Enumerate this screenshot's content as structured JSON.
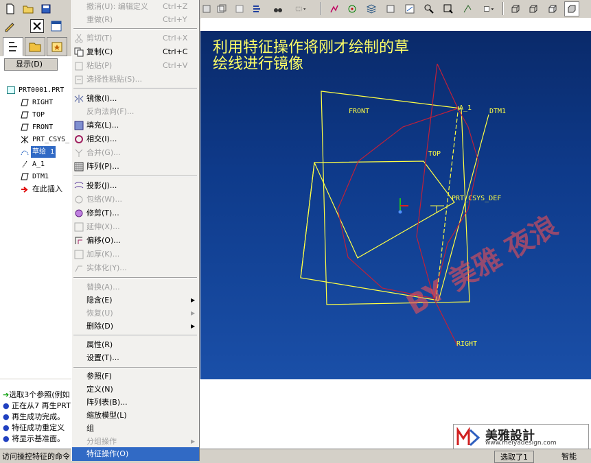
{
  "colors": {
    "caption": "#ffff66",
    "geometry": "#ffff44",
    "sketch": "#c0203a",
    "highlight": "#316ac5",
    "viewport_bg": "#0e3a8a"
  },
  "toolbar": {
    "icons": [
      "new-file-icon",
      "open-folder-icon",
      "save-icon",
      "show-icon",
      "view-icon",
      "repaint-icon",
      "saved-views-icon",
      "datum-plane-display-icon",
      "datum-axis-display-icon",
      "datum-point-display-icon",
      "csys-display-icon",
      "layers-icon",
      "zoom-in-icon",
      "zoom-out-icon",
      "refit-icon",
      "orient-icon",
      "wireframe-icon",
      "hidden-line-icon",
      "no-hidden-icon",
      "shading-icon"
    ]
  },
  "left_panel": {
    "show_button": "显示(D)",
    "tree": [
      {
        "label": "PRT0001.PRT",
        "icon": "part-icon"
      },
      {
        "label": "RIGHT",
        "icon": "datum-plane-icon"
      },
      {
        "label": "TOP",
        "icon": "datum-plane-icon"
      },
      {
        "label": "FRONT",
        "icon": "datum-plane-icon"
      },
      {
        "label": "PRT_CSYS_",
        "icon": "csys-icon"
      },
      {
        "label": "草绘 1",
        "icon": "sketch-icon"
      },
      {
        "label": "A_1",
        "icon": "datum-axis-icon"
      },
      {
        "label": "DTM1",
        "icon": "datum-plane-icon"
      },
      {
        "label": "在此插入",
        "icon": "insert-here-icon"
      }
    ]
  },
  "menu": {
    "items": [
      {
        "label": "撤消(U): 编辑定义",
        "shortcut": "Ctrl+Z",
        "disabled": true,
        "icon": ""
      },
      {
        "label": "重做(R)",
        "shortcut": "Ctrl+Y",
        "disabled": true,
        "icon": ""
      },
      {
        "label": "剪切(T)",
        "shortcut": "Ctrl+X",
        "disabled": true,
        "icon": "cut-icon"
      },
      {
        "label": "复制(C)",
        "shortcut": "Ctrl+C",
        "disabled": false,
        "icon": "copy-icon"
      },
      {
        "label": "粘贴(P)",
        "shortcut": "Ctrl+V",
        "disabled": true,
        "icon": "paste-icon"
      },
      {
        "label": "选择性粘贴(S)...",
        "shortcut": "",
        "disabled": true,
        "icon": "paste-special-icon"
      },
      {
        "label": "镜像(I)...",
        "shortcut": "",
        "disabled": false,
        "icon": "mirror-icon"
      },
      {
        "label": "反向法向(F)...",
        "shortcut": "",
        "disabled": true,
        "icon": ""
      },
      {
        "label": "填充(L)...",
        "shortcut": "",
        "disabled": false,
        "icon": "fill-icon"
      },
      {
        "label": "相交(I)...",
        "shortcut": "",
        "disabled": false,
        "icon": "intersect-icon"
      },
      {
        "label": "合并(G)...",
        "shortcut": "",
        "disabled": true,
        "icon": "merge-icon"
      },
      {
        "label": "阵列(P)...",
        "shortcut": "",
        "disabled": false,
        "icon": "pattern-icon"
      },
      {
        "label": "投影(J)...",
        "shortcut": "",
        "disabled": false,
        "icon": "project-icon"
      },
      {
        "label": "包络(W)...",
        "shortcut": "",
        "disabled": true,
        "icon": "wrap-icon"
      },
      {
        "label": "修剪(T)...",
        "shortcut": "",
        "disabled": false,
        "icon": "trim-icon"
      },
      {
        "label": "延伸(X)...",
        "shortcut": "",
        "disabled": true,
        "icon": "extend-icon"
      },
      {
        "label": "偏移(O)...",
        "shortcut": "",
        "disabled": false,
        "icon": "offset-icon"
      },
      {
        "label": "加厚(K)...",
        "shortcut": "",
        "disabled": true,
        "icon": "thicken-icon"
      },
      {
        "label": "实体化(Y)...",
        "shortcut": "",
        "disabled": true,
        "icon": "solidify-icon"
      },
      {
        "label": "替换(A)...",
        "shortcut": "",
        "disabled": true,
        "icon": ""
      },
      {
        "label": "隐含(E)",
        "shortcut": "",
        "disabled": false,
        "icon": "",
        "submenu": true
      },
      {
        "label": "恢复(U)",
        "shortcut": "",
        "disabled": true,
        "icon": "",
        "submenu": true
      },
      {
        "label": "删除(D)",
        "shortcut": "",
        "disabled": false,
        "icon": "",
        "submenu": true
      },
      {
        "label": "属性(R)",
        "shortcut": "",
        "disabled": false,
        "icon": ""
      },
      {
        "label": "设置(T)...",
        "shortcut": "",
        "disabled": false,
        "icon": ""
      },
      {
        "label": "参照(F)",
        "shortcut": "",
        "disabled": false,
        "icon": ""
      },
      {
        "label": "定义(N)",
        "shortcut": "",
        "disabled": false,
        "icon": ""
      },
      {
        "label": "阵列表(B)...",
        "shortcut": "",
        "disabled": false,
        "icon": ""
      },
      {
        "label": "缩放模型(L)",
        "shortcut": "",
        "disabled": false,
        "icon": ""
      },
      {
        "label": "组",
        "shortcut": "",
        "disabled": false,
        "icon": ""
      },
      {
        "label": "分组操作",
        "shortcut": "",
        "disabled": true,
        "icon": "",
        "submenu": true
      },
      {
        "label": "特征操作(O)",
        "shortcut": "",
        "disabled": false,
        "icon": "",
        "highlighted": true
      }
    ]
  },
  "viewport": {
    "caption_line1": "利用特征操作将刚才绘制的草",
    "caption_line2": "绘线进行镜像",
    "labels": {
      "front": "FRONT",
      "a1": "A_1",
      "dtm1": "DTM1",
      "top": "TOP",
      "csys": "PRT_CSYS_DEF",
      "right": "RIGHT"
    }
  },
  "messages": [
    {
      "kind": "arrow",
      "text": "选取3个参照(例如"
    },
    {
      "kind": "bullet",
      "text": "正在从7 再生PRT"
    },
    {
      "kind": "bullet",
      "text": "再生成功完成。"
    },
    {
      "kind": "bullet",
      "text": "特征成功重定义"
    },
    {
      "kind": "bullet",
      "text": "将显示基准面。"
    }
  ],
  "status": {
    "hint": "访问操控特征的命令",
    "selection": "选取了1",
    "filter": "智能"
  },
  "watermark": "BY 美雅 夜浪",
  "logo": {
    "name": "美雅設計",
    "url": "www.meiyadesign.com"
  }
}
